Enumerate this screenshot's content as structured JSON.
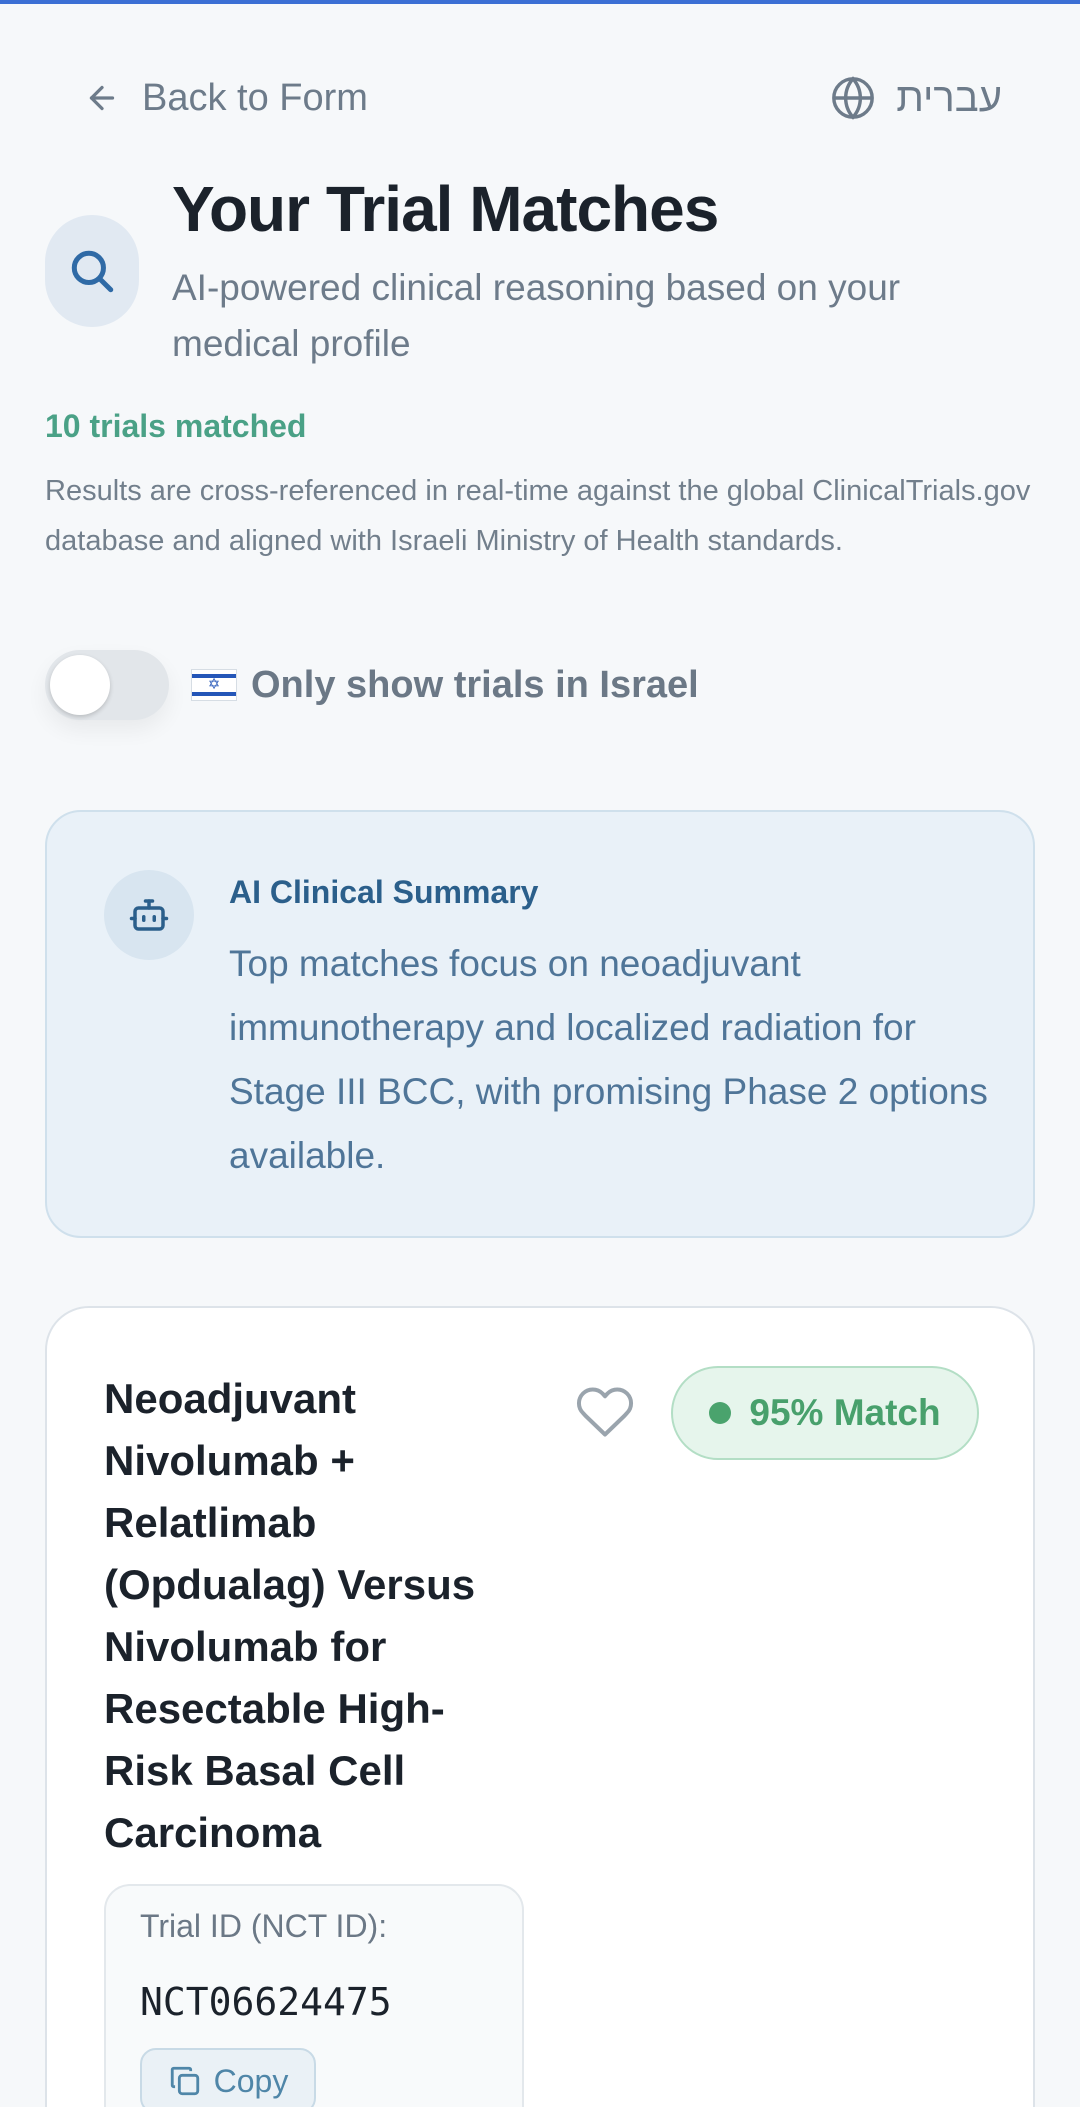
{
  "nav": {
    "back_label": "Back to Form",
    "language_label": "עברית"
  },
  "header": {
    "title": "Your Trial Matches",
    "subtitle": "AI-powered clinical reasoning based on your medical profile"
  },
  "results": {
    "matched_count_text": "10 trials matched",
    "disclaimer": "Results are cross-referenced in real-time against the global ClinicalTrials.gov database and aligned with Israeli Ministry of Health standards."
  },
  "filter": {
    "israel_only_label": "Only show trials in Israel",
    "israel_only_enabled": false
  },
  "summary": {
    "title": "AI Clinical Summary",
    "text": "Top matches focus on neoadjuvant immunotherapy and localized radiation for Stage III BCC, with promising Phase 2 options available."
  },
  "trials": [
    {
      "title": "Neoadjuvant Nivolumab + Relatlimab (Opdualag) Versus Nivolumab for Resectable High-Risk Basal Cell Carcinoma",
      "match_text": "95% Match",
      "id_label": "Trial ID (NCT ID):",
      "nct_id": "NCT06624475",
      "copy_label": "Copy",
      "favorited": false
    }
  ],
  "colors": {
    "accent": "#3b6fd4",
    "match_green": "#48a06c",
    "matched_teal": "#4aa186",
    "summary_blue": "#2b5f8b"
  },
  "icons": [
    "arrow-left-icon",
    "globe-icon",
    "search-icon",
    "israel-flag-icon",
    "robot-icon",
    "heart-icon",
    "copy-icon"
  ]
}
